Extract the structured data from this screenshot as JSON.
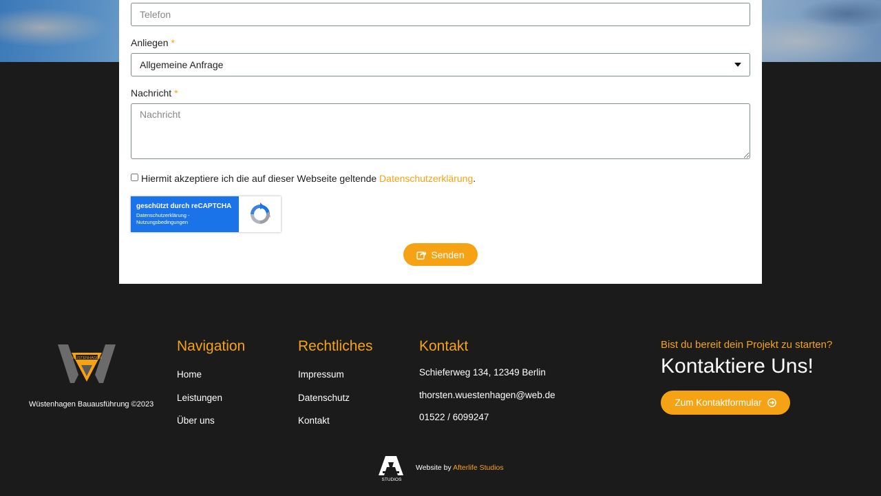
{
  "form": {
    "phone_placeholder": "Telefon",
    "subject_label": "Anliegen",
    "required_mark": "*",
    "subject_selected": "Allgemeine Anfrage",
    "message_label": "Nachricht",
    "message_placeholder": "Nachricht",
    "consent_text": "Hiermit akzeptiere ich die auf dieser Webseite geltende",
    "consent_link": "Datenschutzerklärung",
    "consent_end": ".",
    "recaptcha_title": "geschützt durch reCAPTCHA",
    "recaptcha_links_line1": "Datenschutzerklärung -",
    "recaptcha_links_line2": "Nutzungsbedingungen",
    "send_label": "Senden"
  },
  "footer": {
    "logo_text": "WÜSTENHAGEN",
    "copyright": "Wüstenhagen Bauausführung ©2023",
    "navigation": {
      "title": "Navigation",
      "items": [
        "Home",
        "Leistungen",
        "Über uns"
      ]
    },
    "legal": {
      "title": "Rechtliches",
      "items": [
        "Impressum",
        "Datenschutz",
        "Kontakt"
      ]
    },
    "contact": {
      "title": "Kontakt",
      "address": "Schieferweg 134, 12349 Berlin",
      "email": "thorsten.wuestenhagen@web.de",
      "phone": "01522 / 6099247"
    },
    "cta": {
      "question": "Bist du bereit dein Projekt zu starten?",
      "title": "Kontaktiere Uns!",
      "button": "Zum Kontaktformular"
    },
    "credit": {
      "logo_caption": "STUDIOS",
      "prefix": "Website by",
      "studio": "Afterlife Studios"
    }
  },
  "colors": {
    "accent": "#f5a314",
    "background": "#1b1b1b",
    "recaptcha_blue": "#1a73e8"
  }
}
